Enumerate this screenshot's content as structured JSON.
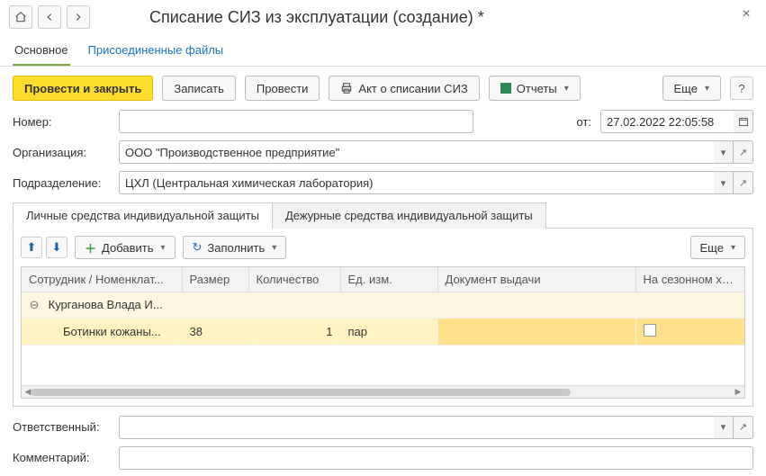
{
  "header": {
    "title": "Списание СИЗ из эксплуатации (создание) *"
  },
  "navTabs": {
    "main": "Основное",
    "files": "Присоединенные файлы"
  },
  "toolbar": {
    "post_close": "Провести и закрыть",
    "save": "Записать",
    "post": "Провести",
    "report_act": "Акт о списании СИЗ",
    "reports": "Отчеты",
    "more": "Еще"
  },
  "form": {
    "number_label": "Номер:",
    "number_value": "",
    "date_label": "от:",
    "date_value": "27.02.2022 22:05:58",
    "org_label": "Организация:",
    "org_value": "ООО \"Производственное предприятие\"",
    "dept_label": "Подразделение:",
    "dept_value": "ЦХЛ (Центральная химическая лаборатория)"
  },
  "subTabs": {
    "personal": "Личные средства индивидуальной защиты",
    "duty": "Дежурные средства индивидуальной защиты"
  },
  "gridToolbar": {
    "add": "Добавить",
    "fill": "Заполнить",
    "more": "Еще"
  },
  "grid": {
    "headers": {
      "emp_nomen": "Сотрудник / Номенклат...",
      "size": "Размер",
      "qty": "Количество",
      "uom": "Ед. изм.",
      "doc": "Документ выдачи",
      "season": "На сезонном хр..."
    },
    "group": "Курганова Влада И...",
    "row": {
      "nomen": "Ботинки кожаны...",
      "size": "38",
      "qty": "1",
      "uom": "пар",
      "doc": "",
      "season_checked": false
    }
  },
  "bottom": {
    "responsible_label": "Ответственный:",
    "responsible_value": "",
    "comment_label": "Комментарий:",
    "comment_value": ""
  }
}
